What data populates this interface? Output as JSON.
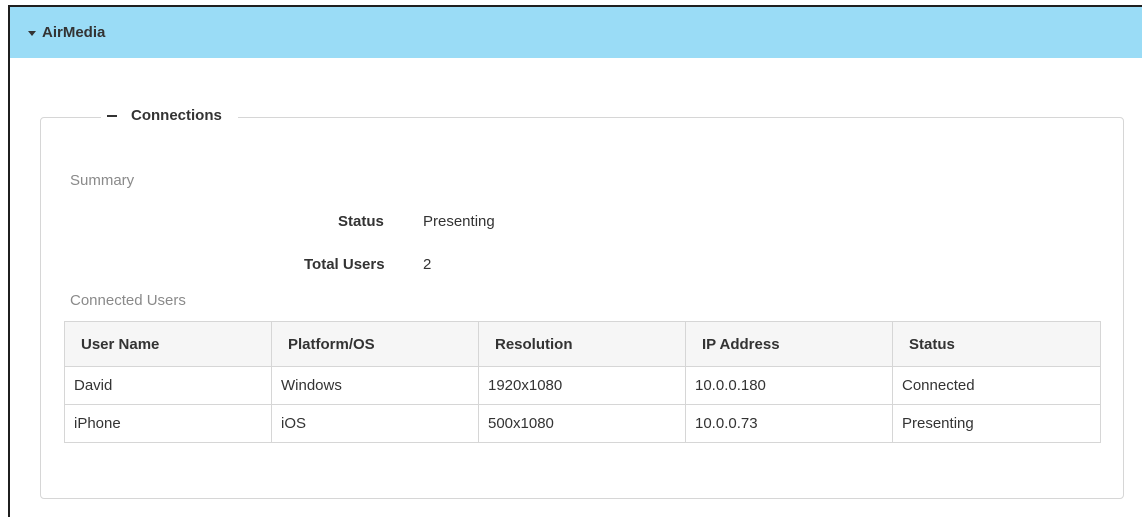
{
  "accordion": {
    "title": "AirMedia"
  },
  "connections": {
    "legend": "Connections",
    "summary_label": "Summary",
    "status_label": "Status",
    "status_value": "Presenting",
    "total_users_label": "Total Users",
    "total_users_value": "2",
    "connected_users_label": "Connected Users"
  },
  "table": {
    "headers": [
      "User Name",
      "Platform/OS",
      "Resolution",
      "IP Address",
      "Status"
    ],
    "rows": [
      [
        "David",
        "Windows",
        "1920x1080",
        "10.0.0.180",
        "Connected"
      ],
      [
        "iPhone",
        "iOS",
        "500x1080",
        "10.0.0.73",
        "Presenting"
      ]
    ]
  },
  "colors": {
    "header_bg": "#9adcf6",
    "border": "#d6d6d6",
    "muted_text": "#8a8a8a"
  }
}
